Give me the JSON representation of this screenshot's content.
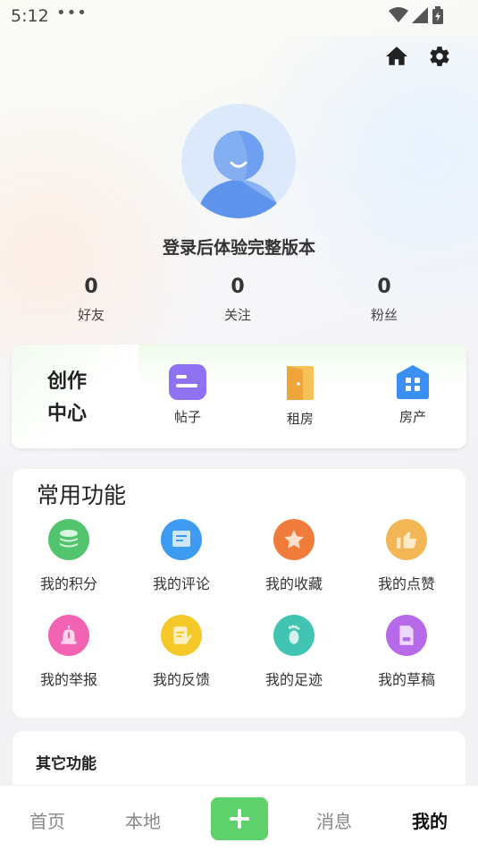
{
  "status": {
    "time": "5:12",
    "more": "•••"
  },
  "user": {
    "name": "登录后体验完整版本"
  },
  "stats": [
    {
      "num": "0",
      "label": "好友"
    },
    {
      "num": "0",
      "label": "关注"
    },
    {
      "num": "0",
      "label": "粉丝"
    }
  ],
  "create": {
    "title": "创作中心",
    "items": [
      {
        "label": "帖子",
        "icon": "post-icon",
        "color": "#8b6cf0"
      },
      {
        "label": "租房",
        "icon": "door-icon",
        "color": "#f0a93a"
      },
      {
        "label": "房产",
        "icon": "house-grid-icon",
        "color": "#3a8ef0"
      }
    ]
  },
  "common": {
    "title": "常用功能",
    "items": [
      {
        "label": "我的积分",
        "icon": "coins-icon",
        "color": "#4fc46a"
      },
      {
        "label": "我的评论",
        "icon": "comment-icon",
        "color": "#3a9af0"
      },
      {
        "label": "我的收藏",
        "icon": "star-icon",
        "color": "#f08038"
      },
      {
        "label": "我的点赞",
        "icon": "thumb-up-icon",
        "color": "#f2b04c"
      },
      {
        "label": "我的举报",
        "icon": "alarm-icon",
        "color": "#f060b0"
      },
      {
        "label": "我的反馈",
        "icon": "feedback-icon",
        "color": "#f5c624"
      },
      {
        "label": "我的足迹",
        "icon": "footprint-icon",
        "color": "#3ec2b0"
      },
      {
        "label": "我的草稿",
        "icon": "draft-icon",
        "color": "#b466e8"
      }
    ]
  },
  "other": {
    "title": "其它功能"
  },
  "tabbar": {
    "home": "首页",
    "local": "本地",
    "messages": "消息",
    "mine": "我的",
    "accent": "#5ed16b"
  }
}
